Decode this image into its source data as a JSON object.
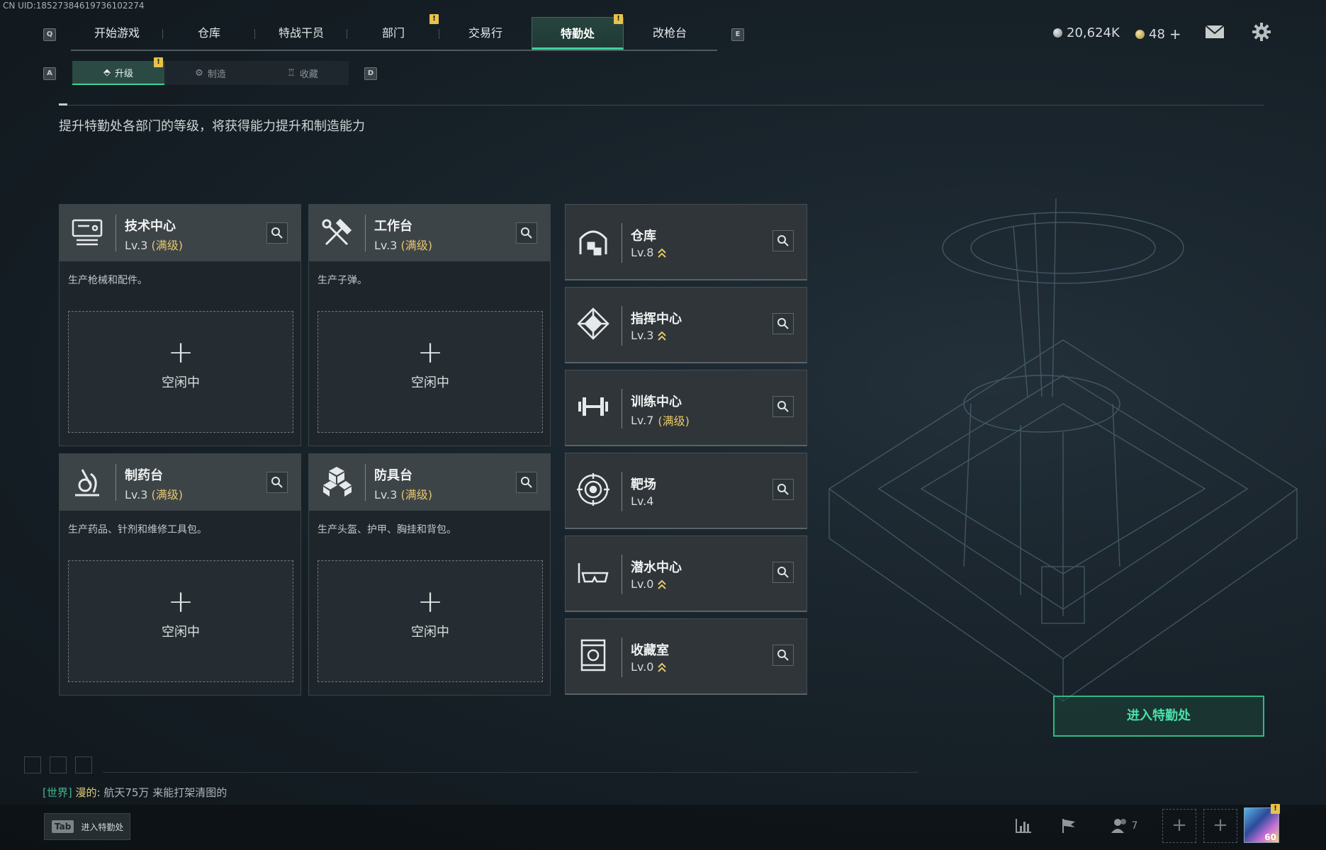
{
  "uid": "CN UID:18527384619736102274",
  "keys": {
    "q": "Q",
    "e": "E",
    "a": "A",
    "d": "D"
  },
  "top_nav": [
    {
      "label": "开始游戏"
    },
    {
      "label": "仓库"
    },
    {
      "label": "特战干员"
    },
    {
      "label": "部门"
    },
    {
      "label": "交易行"
    },
    {
      "label": "特勤处"
    },
    {
      "label": "改枪台"
    }
  ],
  "currency": {
    "coins": "20,624K",
    "tokens": "48"
  },
  "sub_nav": [
    {
      "label": "升级"
    },
    {
      "label": "制造"
    },
    {
      "label": "收藏"
    }
  ],
  "page_description": "提升特勤处各部门的等级，将获得能力提升和制造能力",
  "departments": [
    {
      "title": "技术中心",
      "level": "Lv.3",
      "status": "(满级)",
      "desc": "生产枪械和配件。",
      "slot_plus": "+",
      "slot_status": "空闲中"
    },
    {
      "title": "工作台",
      "level": "Lv.3",
      "status": "(满级)",
      "desc": "生产子弹。",
      "slot_plus": "+",
      "slot_status": "空闲中"
    },
    {
      "title": "制药台",
      "level": "Lv.3",
      "status": "(满级)",
      "desc": "生产药品、针剂和维修工具包。",
      "slot_plus": "+",
      "slot_status": "空闲中"
    },
    {
      "title": "防具台",
      "level": "Lv.3",
      "status": "(满级)",
      "desc": "生产头盔、护甲、胸挂和背包。",
      "slot_plus": "+",
      "slot_status": "空闲中"
    }
  ],
  "facilities": [
    {
      "title": "仓库",
      "level": "Lv.8",
      "status": ""
    },
    {
      "title": "指挥中心",
      "level": "Lv.3",
      "status": ""
    },
    {
      "title": "训练中心",
      "level": "Lv.7",
      "status": "(满级)"
    },
    {
      "title": "靶场",
      "level": "Lv.4",
      "status": ""
    },
    {
      "title": "潜水中心",
      "level": "Lv.0",
      "status": ""
    },
    {
      "title": "收藏室",
      "level": "Lv.0",
      "status": ""
    }
  ],
  "enter_button": "进入特勤处",
  "chat": {
    "channel": "[世界]",
    "user": "漫的:",
    "message": "航天75万 来能打架清图的"
  },
  "bottom": {
    "tab_key": "Tab",
    "tab_label": "进入特勤处",
    "friends_count": "7",
    "avatar_level": "60"
  },
  "colors": {
    "accent": "#3fd29b",
    "gold": "#e6c76a",
    "warning": "#e8c24a"
  }
}
